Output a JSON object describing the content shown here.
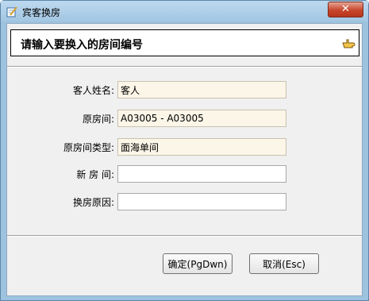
{
  "window": {
    "title": "宾客换房",
    "close_label": "✕"
  },
  "header": {
    "heading": "请输入要换入的房间编号"
  },
  "form": {
    "guest_name": {
      "label": "客人姓名:",
      "value": "客人"
    },
    "original_room": {
      "label": "原房间:",
      "value": "A03005 - A03005"
    },
    "original_room_type": {
      "label": "原房间类型:",
      "value": "面海单间"
    },
    "new_room": {
      "label": "新 房 间:",
      "value": ""
    },
    "reason": {
      "label": "换房原因:",
      "value": ""
    }
  },
  "buttons": {
    "ok_label": "确定(PgDwn)",
    "cancel_label": "取消(Esc)"
  },
  "icons": {
    "app": "notepad-pencil-icon",
    "header": "pointing-hand-icon"
  },
  "colors": {
    "title_bar": "#a3c6e2",
    "close_button": "#c7452b",
    "readonly_field": "#fcf6e8"
  }
}
